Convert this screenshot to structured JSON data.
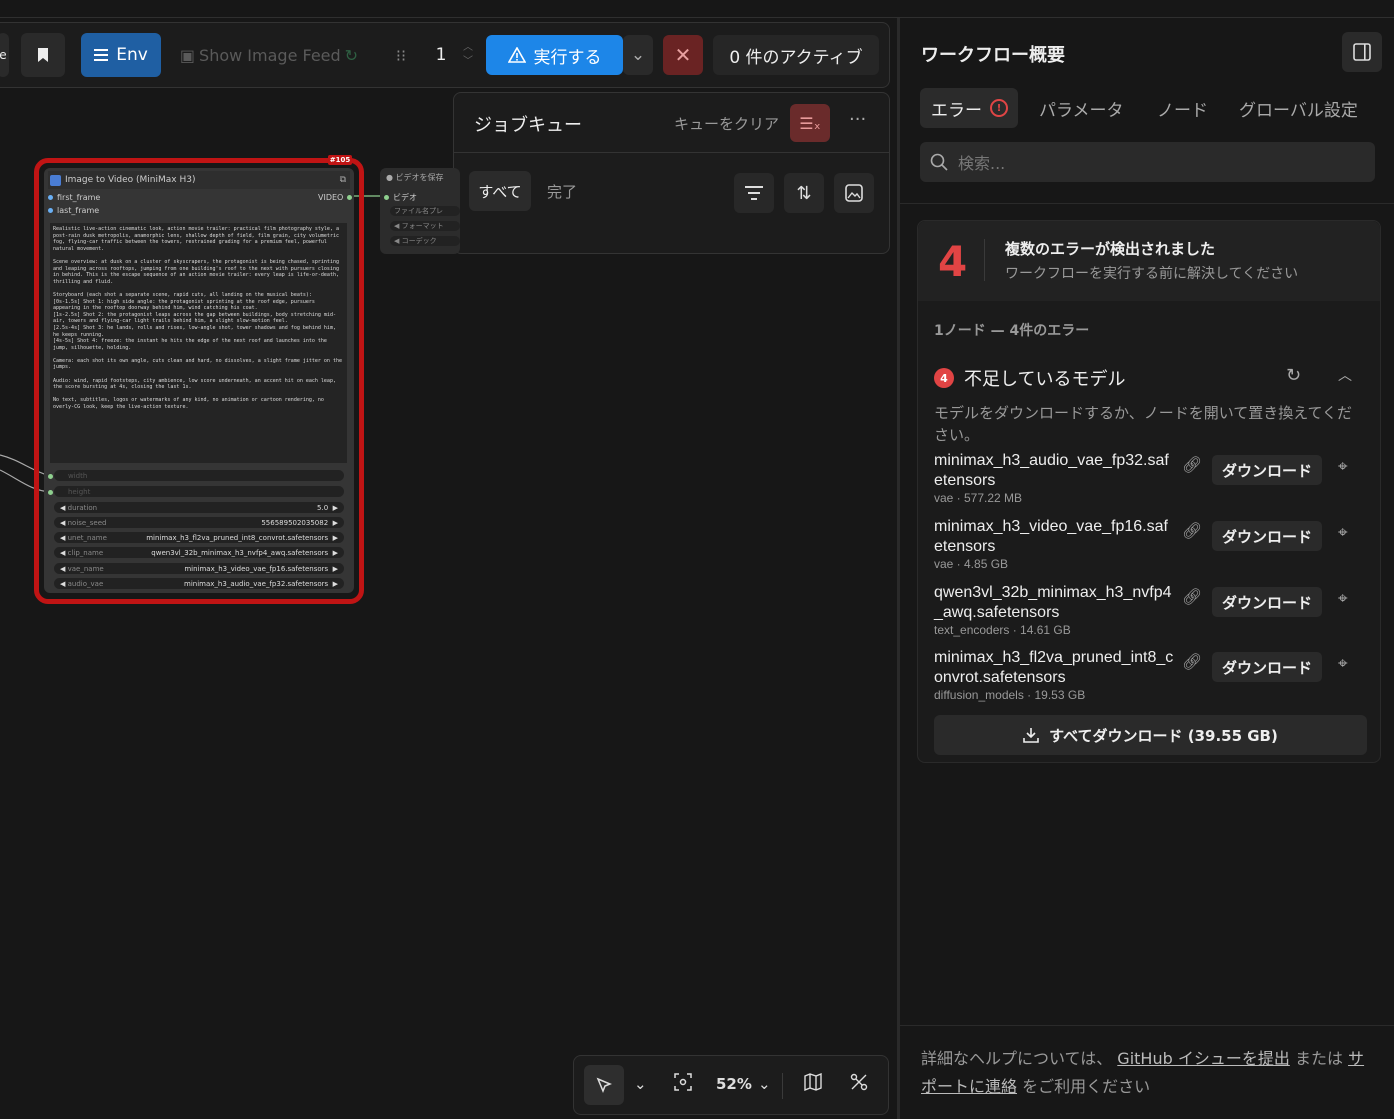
{
  "toolbar": {
    "env_label": "Env",
    "feed_label": "Show Image Feed",
    "batch_count": "1",
    "run_label": "実行する",
    "active_label": "0 件のアクティブ"
  },
  "job_queue": {
    "title": "ジョブキュー",
    "clear_label": "キューをクリア",
    "tab_all": "すべて",
    "tab_done": "完了"
  },
  "node": {
    "id": "#105",
    "title": "Image to Video (MiniMax H3)",
    "inputs": [
      "first_frame",
      "last_frame"
    ],
    "output": "VIDEO",
    "prompt": "Realistic live-action cinematic look, action movie trailer: practical film photography style, a post-rain dusk metropolis, anamorphic lens, shallow depth of field, film grain, city volumetric fog, flying-car traffic between the towers, restrained grading for a premium feel, powerful natural movement.\n\nScene overview: at dusk on a cluster of skyscrapers, the protagonist is being chased, sprinting and leaping across rooftops, jumping from one building's roof to the next with pursuers closing in behind. This is the escape sequence of an action movie trailer: every leap is life-or-death, thrilling and fluid.\n\nStoryboard (each shot a separate scene, rapid cuts, all landing on the musical beats):\n[0s-1.5s] Shot 1: high side angle: the protagonist sprinting at the roof edge, pursuers appearing in the rooftop doorway behind him, wind catching his coat.\n[1s-2.5s] Shot 2: the protagonist leaps across the gap between buildings, body stretching mid-air, towers and flying-car light trails behind him, a slight slow-motion feel.\n[2.5s-4s] Shot 3: he lands, rolls and rises, low-angle shot, tower shadows and fog behind him, he keeps running.\n[4s-5s] Shot 4: freeze: the instant he hits the edge of the next roof and launches into the jump, silhouette, holding.\n\nCamera: each shot its own angle, cuts clean and hard, no dissolves, a slight frame jitter on the jumps.\n\nAudio: wind, rapid footsteps, city ambience, low score underneath, an accent hit on each leap, the score bursting at 4s, closing the last 1s.\n\nNo text, subtitles, logos or watermarks of any kind, no animation or cartoon rendering, no overly-CG look, keep the live-action texture.",
    "disabled_widgets": [
      "width",
      "height"
    ],
    "widgets": [
      {
        "name": "duration",
        "value": "5.0"
      },
      {
        "name": "noise_seed",
        "value": "556589502035082"
      },
      {
        "name": "unet_name",
        "value": "minimax_h3_fl2va_pruned_int8_convrot.safetensors"
      },
      {
        "name": "clip_name",
        "value": "qwen3vl_32b_minimax_h3_nvfp4_awq.safetensors"
      },
      {
        "name": "vae_name",
        "value": "minimax_h3_video_vae_fp16.safetensors"
      },
      {
        "name": "audio_vae",
        "value": "minimax_h3_audio_vae_fp32.safetensors"
      }
    ]
  },
  "save_node": {
    "title": "ビデオを保存",
    "input": "ビデオ",
    "widgets": [
      "ファイル名プレ",
      "フォーマット",
      "コーデック"
    ]
  },
  "canvas_toolbar": {
    "zoom": "52%"
  },
  "panel": {
    "title": "ワークフロー概要",
    "tabs": [
      "エラー",
      "パラメータ",
      "ノード",
      "グローバル設定"
    ],
    "error_tab_icon": "!",
    "search_placeholder": "検索...",
    "error_count": "4",
    "error_title": "複数のエラーが検出されました",
    "error_subtitle": "ワークフローを実行する前に解決してください",
    "summary": "1ノード — 4件のエラー",
    "group_title": "不足しているモデル",
    "group_count": "4",
    "group_desc": "モデルをダウンロードするか、ノードを開いて置き換えてください。",
    "download_label": "ダウンロード",
    "models": [
      {
        "name": "minimax_h3_audio_vae_fp32.safetensors",
        "meta": "vae · 577.22 MB"
      },
      {
        "name": "minimax_h3_video_vae_fp16.safetensors",
        "meta": "vae · 4.85 GB"
      },
      {
        "name": "qwen3vl_32b_minimax_h3_nvfp4_awq.safetensors",
        "meta": "text_encoders · 14.61 GB"
      },
      {
        "name": "minimax_h3_fl2va_pruned_int8_convrot.safetensors",
        "meta": "diffusion_models · 19.53 GB"
      }
    ],
    "download_all": "すべてダウンロード (39.55 GB)",
    "footer": {
      "before": "詳細なヘルプについては、",
      "github_link": "GitHub イシューを提出",
      "middle": "または",
      "support_link": "サポートに連絡",
      "after": "をご利用ください"
    }
  },
  "colors": {
    "accent": "#1d86e8",
    "error": "#e14444",
    "env": "#1f5fa3"
  }
}
